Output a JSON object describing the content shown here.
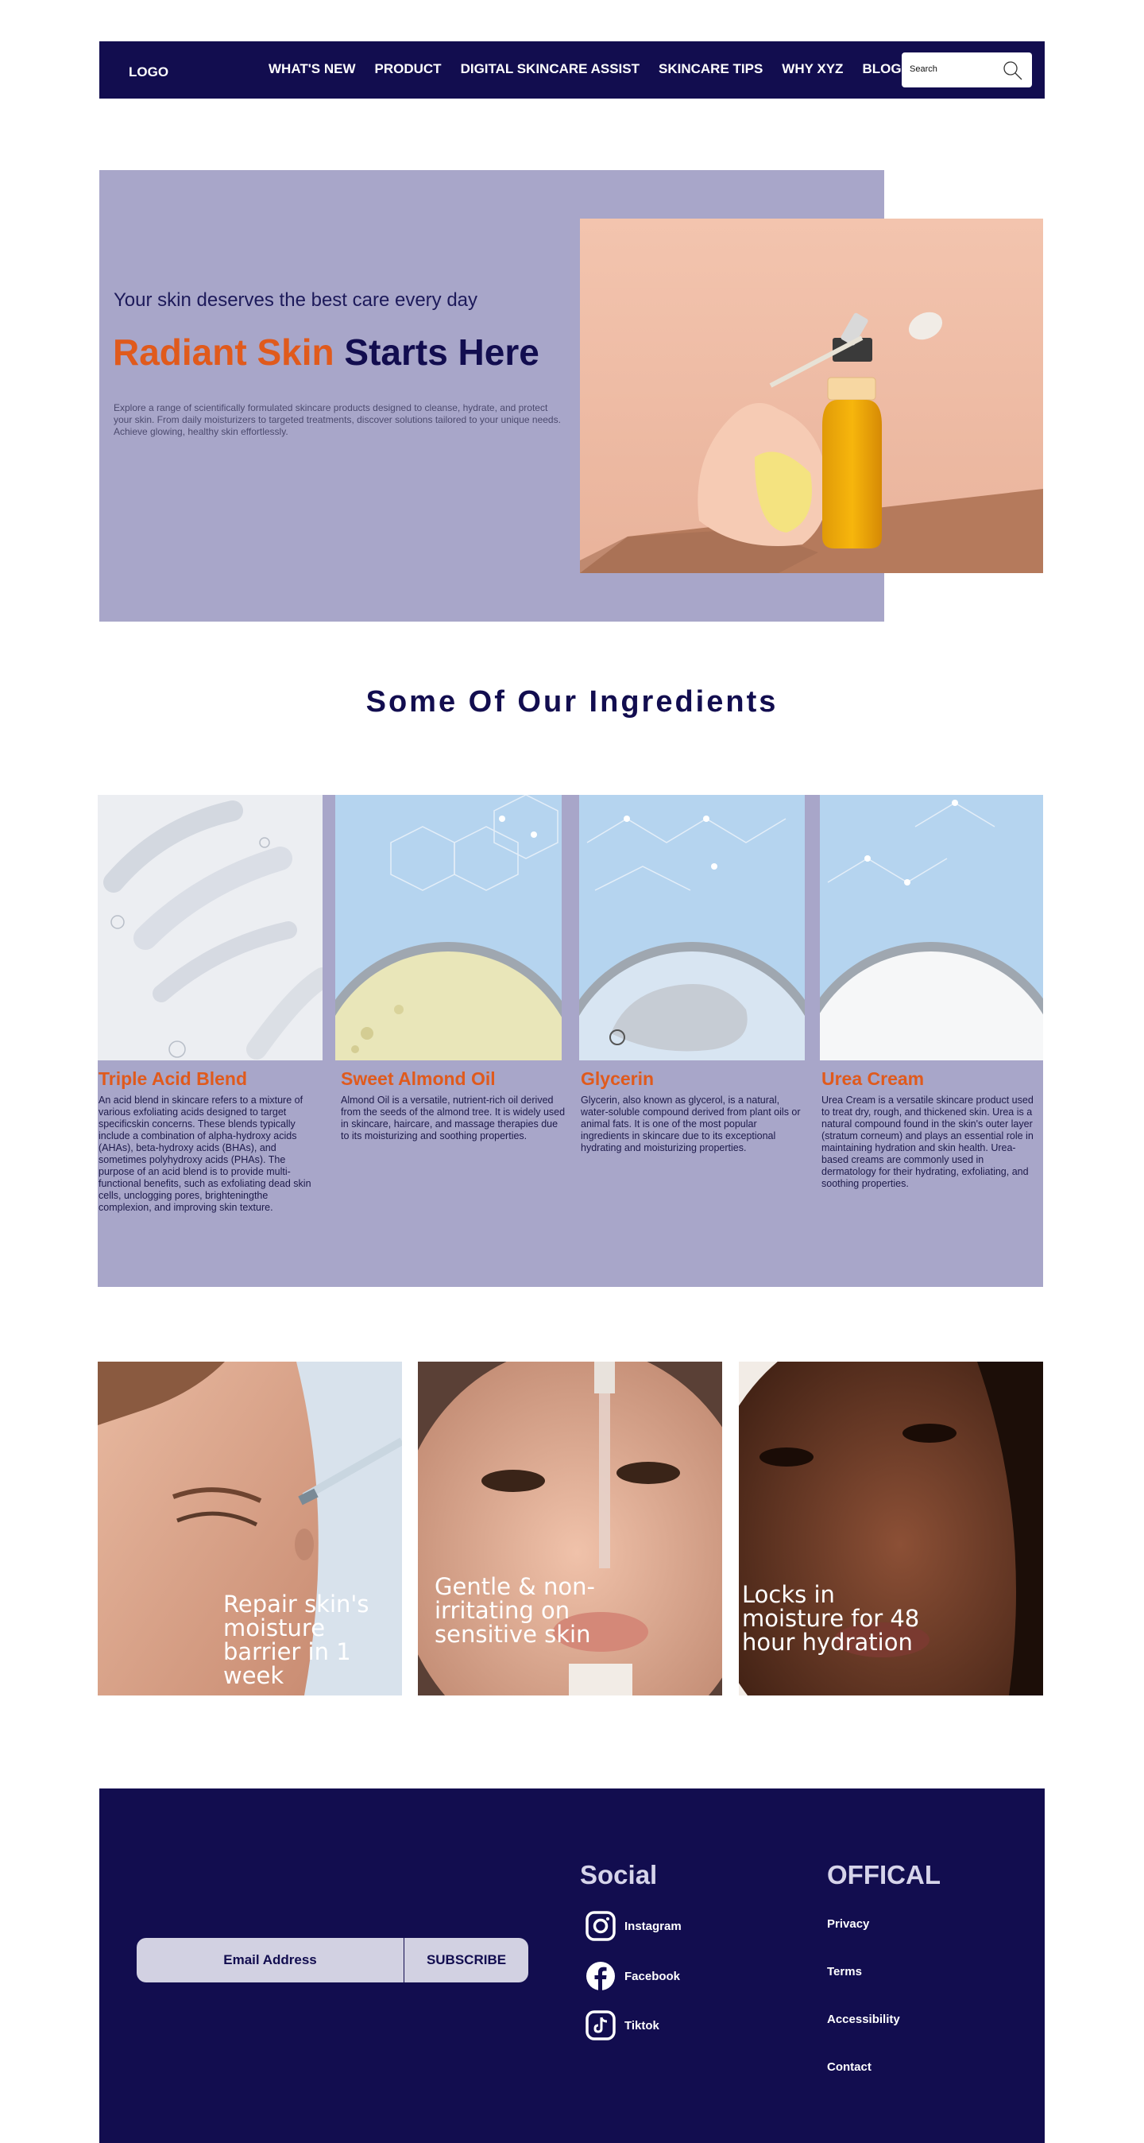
{
  "nav": {
    "logo": "LOGO",
    "links": [
      "WHAT'S NEW",
      "PRODUCT",
      "DIGITAL SKINCARE ASSIST",
      "SKINCARE TIPS",
      "WHY XYZ",
      "BLOGS"
    ],
    "search_placeholder": "Search"
  },
  "hero": {
    "tagline": "Your skin deserves the best care every day",
    "title_highlight": "Radiant Skin",
    "title_rest": "Starts Here",
    "description": "Explore a range of scientifically formulated skincare products designed to cleanse, hydrate, and protect your skin. From daily moisturizers to targeted treatments, discover solutions tailored to your unique needs. Achieve glowing, healthy skin effortlessly."
  },
  "ingredients": {
    "title": "Some Of Our Ingredients",
    "items": [
      {
        "name": "Triple Acid Blend",
        "description": "An acid blend in skincare refers to a mixture of various exfoliating acids designed to target specificskin concerns. These blends typically include a combination of alpha-hydroxy acids (AHAs), beta-hydroxy acids (BHAs), and sometimes polyhydroxy acids (PHAs). The purpose of an acid blend is to provide multi-functional benefits, such as exfoliating dead skin cells, unclogging pores, brighteningthe complexion, and improving skin texture."
      },
      {
        "name": "Sweet Almond Oil",
        "description": "Almond Oil is a versatile, nutrient-rich oil derived from the seeds of the almond tree. It is widely used in skincare, haircare, and massage therapies due to its moisturizing and soothing properties."
      },
      {
        "name": "Glycerin",
        "description": "Glycerin, also known as glycerol, is a natural, water-soluble compound derived from plant oils or animal fats. It is one of the most popular ingredients in skincare due to its exceptional hydrating and moisturizing properties."
      },
      {
        "name": "Urea Cream",
        "description": "Urea Cream is a versatile skincare product used to treat dry, rough, and thickened skin. Urea is a natural compound found in the skin's outer layer (stratum corneum) and plays an essential role in maintaining hydration and skin health. Urea-based creams are commonly used in dermatology for their hydrating, exfoliating, and soothing properties."
      }
    ]
  },
  "promos": [
    {
      "text": "Repair skin's moisture barrier in 1 week"
    },
    {
      "text": "Gentle & non-irritating on sensitive skin"
    },
    {
      "text": "Locks in moisture for 48 hour hydration"
    }
  ],
  "footer": {
    "email_placeholder": "Email Address",
    "subscribe_label": "SUBSCRIBE",
    "social_heading": "Social",
    "social_links": [
      "Instagram",
      "Facebook",
      "Tiktok"
    ],
    "official_heading": "OFFICAL",
    "official_links": [
      "Privacy",
      "Terms",
      "Accessibility",
      "Contact"
    ]
  },
  "colors": {
    "navy": "#120d4f",
    "lavender": "#a8a6c9",
    "accent_orange": "#e05a1c",
    "petri_blue": "#b5d4ef"
  }
}
